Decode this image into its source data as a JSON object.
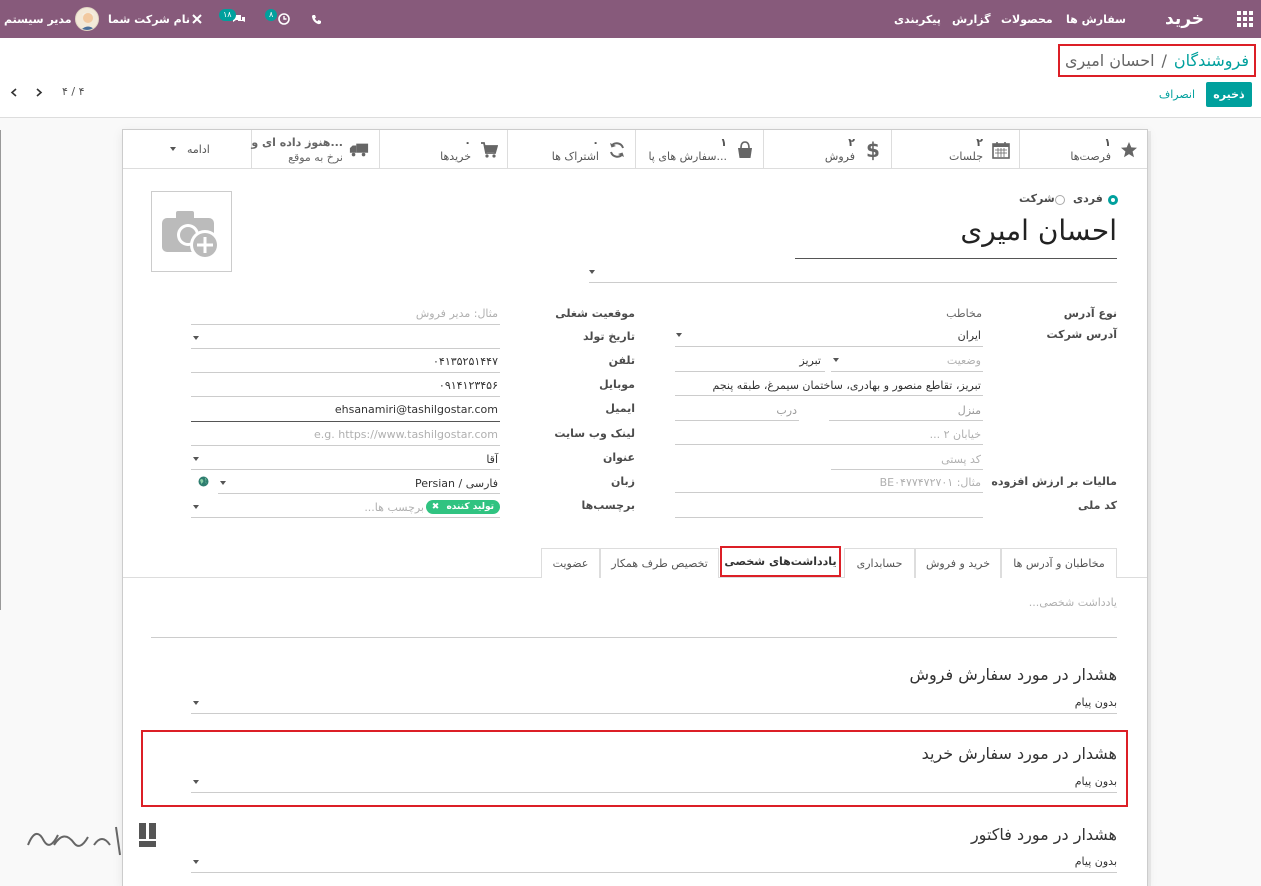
{
  "navbar": {
    "app_title": "خرید",
    "menu": [
      "سفارش ها",
      "محصولات",
      "گزارش",
      "پیکربندی"
    ],
    "company": "نام شرکت شما",
    "user": "مدیر سیستم",
    "activity_count": "۸",
    "messages_count": "۱۸"
  },
  "control_panel": {
    "breadcrumb_parent": "فروشندگان",
    "breadcrumb_sep": "/",
    "breadcrumb_current": "احسان امیری",
    "save_label": "ذخیره",
    "discard_label": "انصراف",
    "pager": "۴ / ۴"
  },
  "smart_buttons": {
    "opportunities": {
      "value": "۱",
      "label": "فرصت‌ها"
    },
    "meetings": {
      "value": "۲",
      "label": "جلسات"
    },
    "sales": {
      "value": "۲",
      "label": "فروش"
    },
    "pos_orders": {
      "value": "۱",
      "label": "سفارش های پا..."
    },
    "subscriptions": {
      "value": "۰",
      "label": "اشتراک ها"
    },
    "purchases": {
      "value": "۰",
      "label": "خریدها"
    },
    "on_time": {
      "line1": "هنوز داده ای و...",
      "line2": "نرخ به موقع"
    },
    "more_label": "ادامه"
  },
  "partner": {
    "type_individual": "فردی",
    "type_company": "شرکت",
    "name": "احسان امیری"
  },
  "left_col": {
    "address_type_label": "نوع آدرس",
    "address_type_value": "مخاطب",
    "company_address_label": "آدرس شرکت",
    "country": "ایران",
    "state_placeholder": "وضعیت",
    "city": "تبریز",
    "street": "تبریز، تقاطع منصور و بهادری، ساختمان سیمرغ، طبقه پنجم",
    "house_placeholder": "منزل",
    "door_placeholder": "درب",
    "street2_placeholder": "خیابان ۲ ...",
    "zip_placeholder": "کد پستی",
    "vat_label": "مالیات بر ارزش افزوده",
    "vat_placeholder": "مثال: BE۰۴۷۷۴۷۲۷۰۱",
    "national_code_label": "کد ملی"
  },
  "right_col": {
    "job_label": "موقعیت شغلی",
    "job_placeholder": "مثال: مدیر فروش",
    "birthday_label": "تاریخ تولد",
    "phone_label": "تلفن",
    "phone": "۰۴۱۳۵۲۵۱۴۴۷",
    "mobile_label": "موبایل",
    "mobile": "۰۹۱۴۱۲۳۴۵۶",
    "email_label": "ایمیل",
    "email": "ehsanamiri@tashilgostar.com",
    "website_label": "لینک وب سایت",
    "website_placeholder": "e.g. https://www.tashilgostar.com",
    "title_label": "عنوان",
    "title_value": "آقا",
    "language_label": "زبان",
    "language_value": "Persian / فارسی",
    "tags_label": "برچسب‌ها",
    "tag": "تولید کننده",
    "tags_placeholder": "برچسب ها..."
  },
  "tabs": [
    "مخاطبان و آدرس ها",
    "خرید و فروش",
    "حسابداری",
    "یادداشت‌های شخصی",
    "تخصیص طرف همکار",
    "عضویت"
  ],
  "notes": {
    "personal_placeholder": "یادداشت شخصی...",
    "sale_warning_title": "هشدار در مورد سفارش فروش",
    "sale_warning_value": "بدون پیام",
    "purchase_warning_title": "هشدار در مورد سفارش خرید",
    "purchase_warning_value": "بدون پیام",
    "invoice_warning_title": "هشدار در مورد فاکتور",
    "invoice_warning_value": "بدون پیام"
  },
  "colors": {
    "navbar": "#875a7b",
    "accent": "#00a09d",
    "highlight": "#dc1f26",
    "tag": "#30c381"
  }
}
